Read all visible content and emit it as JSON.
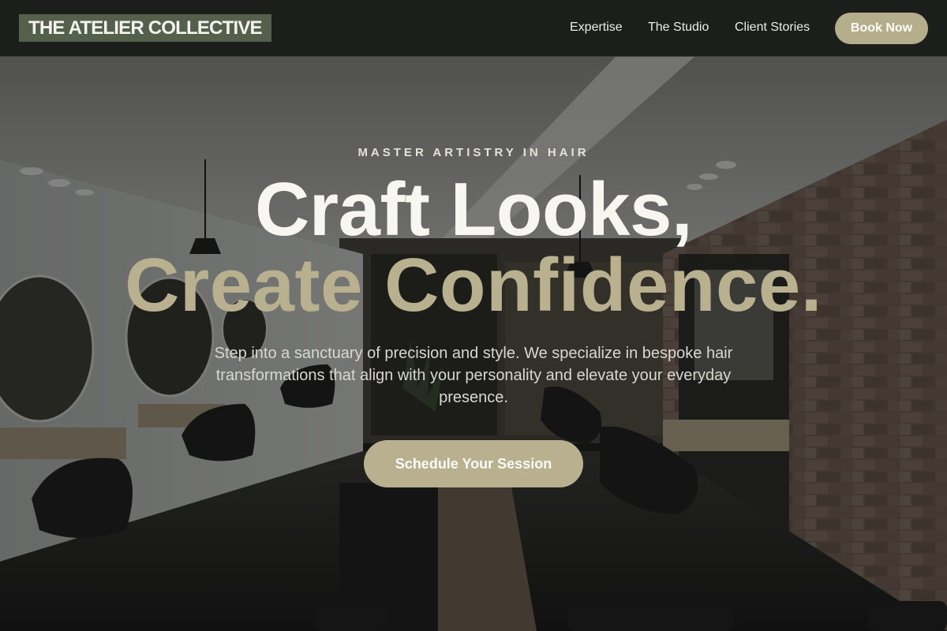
{
  "brand": {
    "name": "THE ATELIER COLLECTIVE"
  },
  "nav": {
    "links": [
      {
        "label": "Expertise"
      },
      {
        "label": "The Studio"
      },
      {
        "label": "Client Stories"
      }
    ],
    "book_label": "Book Now"
  },
  "hero": {
    "eyebrow": "MASTER ARTISTRY IN HAIR",
    "headline_line1": "Craft Looks,",
    "headline_line2": "Create Confidence.",
    "subtext": "Step into a sanctuary of precision and style. We specialize in bespoke hair transformations that align with your personality and elevate your everyday presence.",
    "cta_label": "Schedule Your Session"
  },
  "colors": {
    "nav_bg": "#1c1e1b",
    "logo_bg": "#55604c",
    "accent": "#b8b08f",
    "text_light": "#f7f6f1"
  }
}
